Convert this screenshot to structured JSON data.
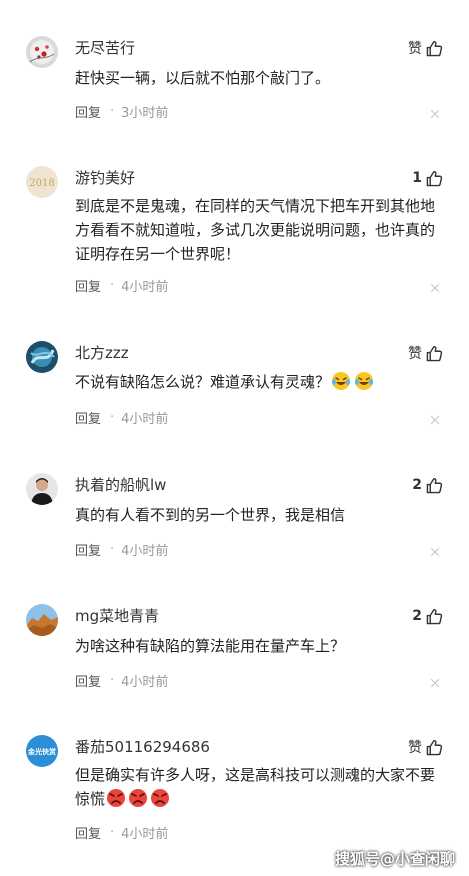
{
  "colors": {
    "text": "#222222",
    "meta": "#999999",
    "background": "#ffffff"
  },
  "comments": [
    {
      "username": "无尽苦行",
      "like_label": "赞",
      "like_count": "",
      "text": "赶快买一辆，以后就不怕那个敲门了。",
      "reply_label": "回复",
      "time": "3小时前",
      "avatar_icon": "cherry-blossom-avatar"
    },
    {
      "username": "游钓美好",
      "like_label": "",
      "like_count": "1",
      "text": "到底是不是鬼魂，在同样的天气情况下把车开到其他地方看看不就知道啦，多试几次更能说明问题，也许真的证明存在另一个世界呢！",
      "reply_label": "回复",
      "time": "4小时前",
      "avatar_icon": "year-2018-avatar",
      "avatar_text": "2018"
    },
    {
      "username": "北方zzz",
      "like_label": "赞",
      "like_count": "",
      "text": "不说有缺陷怎么说？难道承认有灵魂？",
      "emoji": "laughing-tears",
      "reply_label": "回复",
      "time": "4小时前",
      "avatar_icon": "blue-swirl-avatar"
    },
    {
      "username": "执着的船帆lw",
      "like_label": "",
      "like_count": "2",
      "text": "真的有人看不到的另一个世界，我是相信",
      "reply_label": "回复",
      "time": "4小时前",
      "avatar_icon": "man-portrait-avatar"
    },
    {
      "username": "mg菜地青青",
      "like_label": "",
      "like_count": "2",
      "text": "为啥这种有缺陷的算法能用在量产车上？",
      "reply_label": "回复",
      "time": "4小时前",
      "avatar_icon": "desert-rock-avatar"
    },
    {
      "username": "番茄50116294686",
      "like_label": "赞",
      "like_count": "",
      "text": "但是确实有许多人呀，这是高科技可以测魂的大家不要惊慌",
      "emoji": "angry-face",
      "reply_label": "回复",
      "time": "4小时前",
      "avatar_icon": "calligraphy-avatar",
      "avatar_text": "金光快赏"
    }
  ],
  "watermark": "搜狐号@小查闲聊"
}
